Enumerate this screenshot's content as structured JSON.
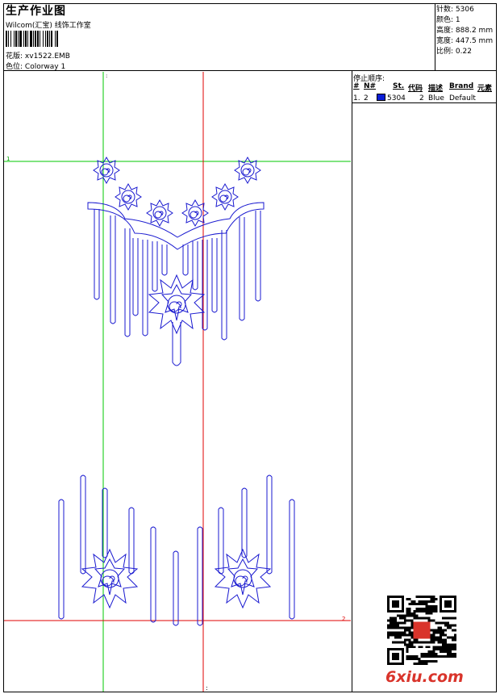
{
  "header": {
    "title": "生产作业图",
    "company": "Wilcom(汇宝) 线饰工作室",
    "design_label": "花版:",
    "design_value": "xv1522.EMB",
    "colorway_label": "色位:",
    "colorway_value": "Colorway 1"
  },
  "stats": [
    {
      "label": "针数:",
      "value": "5306"
    },
    {
      "label": "颜色:",
      "value": "1"
    },
    {
      "label": "高度:",
      "value": "888.2 mm"
    },
    {
      "label": "宽度:",
      "value": "447.5 mm"
    },
    {
      "label": "比例:",
      "value": "0.22"
    }
  ],
  "stop_sequence": {
    "title": "停止顺序:",
    "headers": [
      "#",
      "N#",
      "St.",
      "代码",
      "描述",
      "Brand",
      "元素"
    ],
    "rows": [
      {
        "index": "1.",
        "needle": "2",
        "color": "#0a1ed6",
        "stitches": "5304",
        "code": "2",
        "description": "Blue",
        "brand": "Default",
        "elements": ""
      }
    ]
  },
  "canvas_markers": {
    "top_left": "1",
    "top_right": "2",
    "bottom_mark": ":"
  },
  "colors": {
    "thread": "#1a1ad0",
    "guide_green": "#00c800",
    "guide_red": "#e00000",
    "logo": "#d9342b"
  },
  "watermark": {
    "logo_text": "6xiu.com",
    "qr_caption": "6xiu"
  }
}
